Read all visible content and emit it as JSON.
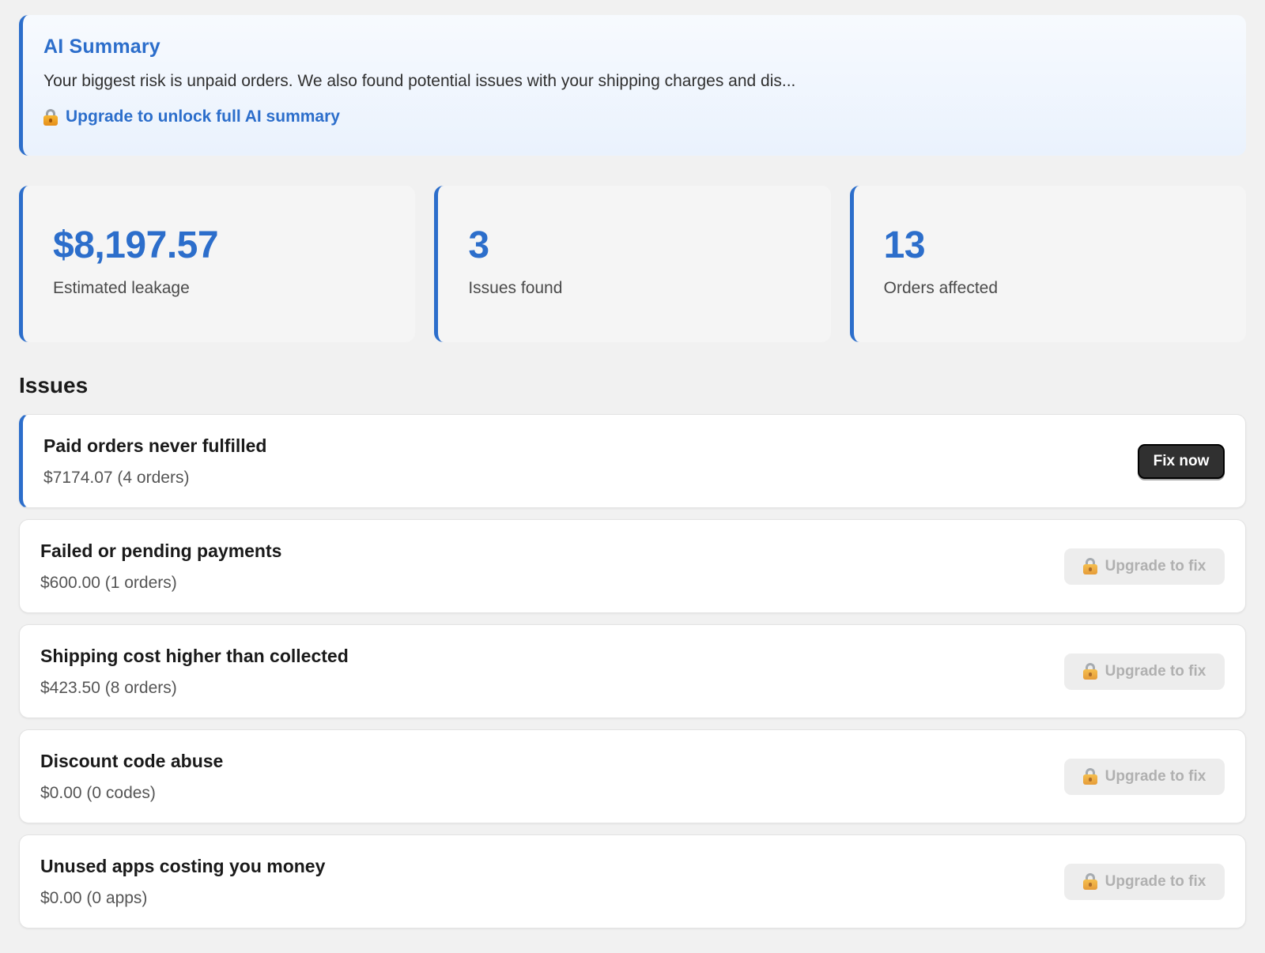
{
  "ai_summary": {
    "title": "AI Summary",
    "text": "Your biggest risk is unpaid orders. We also found potential issues with your shipping charges and dis...",
    "upgrade_link": "Upgrade to unlock full AI summary",
    "icon": "lock-icon"
  },
  "stats": [
    {
      "value": "$8,197.57",
      "label": "Estimated leakage"
    },
    {
      "value": "3",
      "label": "Issues found"
    },
    {
      "value": "13",
      "label": "Orders affected"
    }
  ],
  "issues": {
    "heading": "Issues",
    "items": [
      {
        "title": "Paid orders never fulfilled",
        "detail": "$7174.07 (4 orders)",
        "action": "Fix now",
        "locked": false
      },
      {
        "title": "Failed or pending payments",
        "detail": "$600.00 (1 orders)",
        "action": "Upgrade to fix",
        "locked": true
      },
      {
        "title": "Shipping cost higher than collected",
        "detail": "$423.50 (8 orders)",
        "action": "Upgrade to fix",
        "locked": true
      },
      {
        "title": "Discount code abuse",
        "detail": "$0.00 (0 codes)",
        "action": "Upgrade to fix",
        "locked": true
      },
      {
        "title": "Unused apps costing you money",
        "detail": "$0.00 (0 apps)",
        "action": "Upgrade to fix",
        "locked": true
      }
    ]
  },
  "colors": {
    "accent": "#2c6ecb",
    "fix_button": "#303030",
    "upgrade_button_bg": "#ededed",
    "lock": "#f0a020"
  }
}
